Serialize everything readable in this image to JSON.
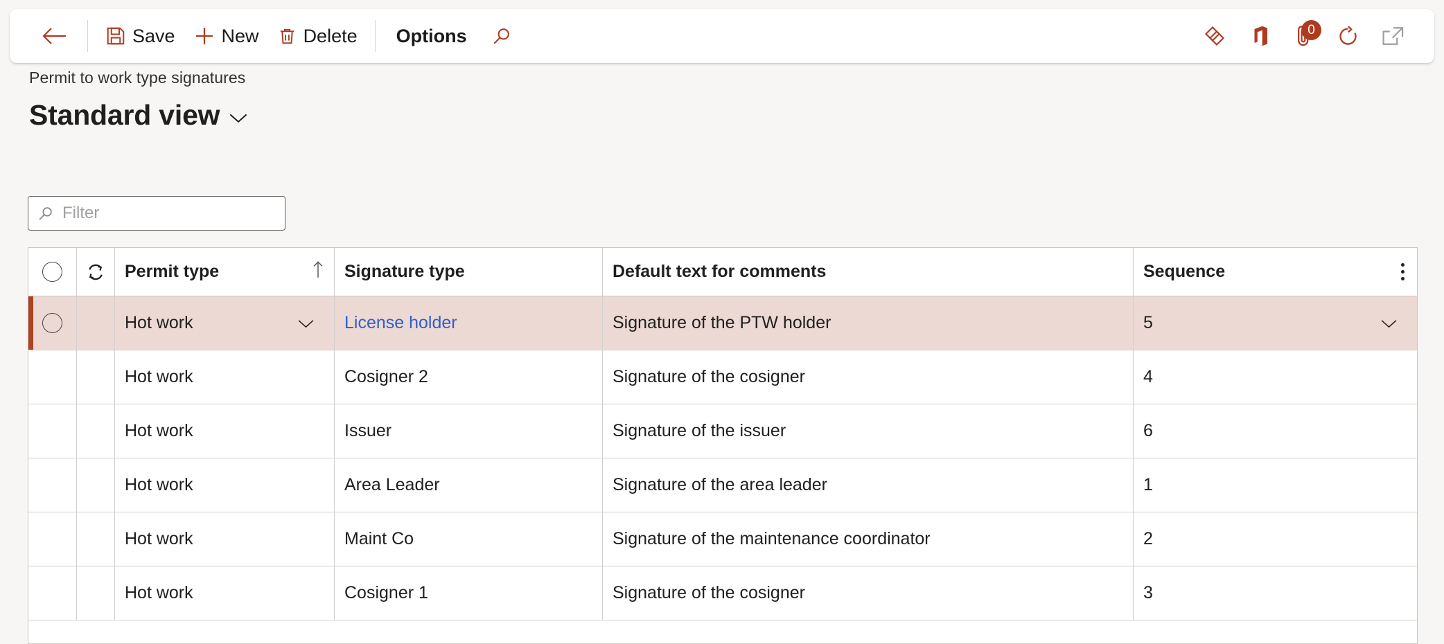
{
  "colors": {
    "accent": "#b03a20",
    "selected_row_bg": "#ecd9d3",
    "selected_row_indicator": "#b0431f",
    "link": "#2f5ecb",
    "page_bg": "#f7f6f5"
  },
  "commandbar": {
    "back_icon": "back-arrow-icon",
    "buttons": [
      {
        "label": "Save",
        "icon": "save-floppy-icon"
      },
      {
        "label": "New",
        "icon": "plus-icon"
      },
      {
        "label": "Delete",
        "icon": "trash-icon"
      },
      {
        "label": "Options",
        "icon": ""
      }
    ],
    "search_icon": "search-icon",
    "right_icons": [
      {
        "name": "relationships-diamond-icon"
      },
      {
        "name": "office-app-icon"
      },
      {
        "name": "attachments-paperclip-icon",
        "badge": "0"
      },
      {
        "name": "refresh-icon"
      },
      {
        "name": "open-in-new-window-icon"
      }
    ]
  },
  "header": {
    "caption": "Permit to work type signatures",
    "title": "Standard view",
    "title_chevron_icon": "chevron-down-icon"
  },
  "filter": {
    "icon": "search-icon",
    "value": "",
    "placeholder": "Filter"
  },
  "grid": {
    "select_all_icon": "select-all-circle-icon",
    "sync_icon": "sync-icon",
    "sort_indicator": "↑",
    "overflow_icon": "kebab-menu-icon",
    "columns": [
      {
        "key": "permit_type",
        "label": "Permit type",
        "sorted": "asc"
      },
      {
        "key": "signature_type",
        "label": "Signature type"
      },
      {
        "key": "default_text",
        "label": "Default text for comments"
      },
      {
        "key": "sequence",
        "label": "Sequence"
      }
    ],
    "rows": [
      {
        "selected": true,
        "permit_type": "Hot work",
        "signature_type": "License holder",
        "signature_type_is_link": true,
        "default_text": "Signature of the PTW holder",
        "sequence": "5"
      },
      {
        "selected": false,
        "permit_type": "Hot work",
        "signature_type": "Cosigner 2",
        "signature_type_is_link": false,
        "default_text": "Signature of the cosigner",
        "sequence": "4"
      },
      {
        "selected": false,
        "permit_type": "Hot work",
        "signature_type": "Issuer",
        "signature_type_is_link": false,
        "default_text": "Signature of the issuer",
        "sequence": "6"
      },
      {
        "selected": false,
        "permit_type": "Hot work",
        "signature_type": "Area Leader",
        "signature_type_is_link": false,
        "default_text": "Signature of the area leader",
        "sequence": "1"
      },
      {
        "selected": false,
        "permit_type": "Hot work",
        "signature_type": "Maint Co",
        "signature_type_is_link": false,
        "default_text": "Signature of the maintenance coordinator",
        "sequence": "2"
      },
      {
        "selected": false,
        "permit_type": "Hot work",
        "signature_type": "Cosigner 1",
        "signature_type_is_link": false,
        "default_text": "Signature of the cosigner",
        "sequence": "3"
      }
    ]
  }
}
